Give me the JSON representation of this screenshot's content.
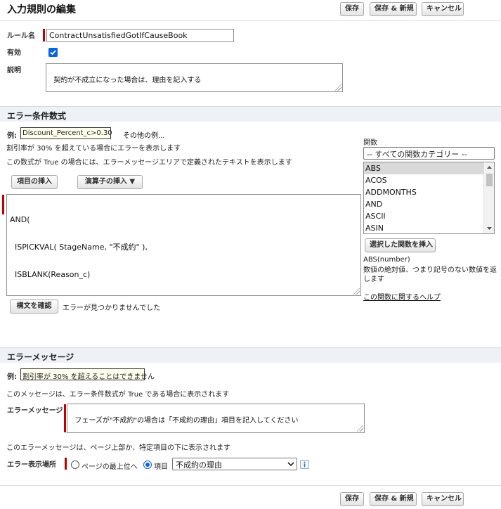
{
  "header": {
    "title": "入力規則の編集",
    "save": "保存",
    "save_new": "保存 & 新規",
    "cancel": "キャンセル"
  },
  "rule": {
    "name_label": "ルール名",
    "name_value": "ContractUnsatisfiedGotIfCauseBook",
    "active_label": "有効",
    "active_checked": true,
    "description_label": "説明",
    "description_value": "契約が不成立になった場合は、理由を記入する"
  },
  "formula_section": {
    "title": "エラー条件数式",
    "example_label": "例:",
    "example_value": "Discount_Percent_c>0.30",
    "more_examples": "その他の例...",
    "hint1": "割引率が 30% を超えている場合にエラーを表示します",
    "hint2": "この数式が True の場合には、エラーメッセージエリアで定義されたテキストを表示します",
    "insert_field": "項目の挿入",
    "insert_operator": "演算子の挿入 ▼",
    "formula_lines": [
      "AND(",
      "  ISPICKVAL( StageName, \"不成約\" ),",
      "  ISBLANK(Reason_c)",
      ")"
    ],
    "check_syntax": "構文を確認",
    "syntax_result": "エラーが見つかりませんでした"
  },
  "functions": {
    "label": "関数",
    "category": "-- すべての関数カテゴリー --",
    "items": [
      "ABS",
      "ACOS",
      "ADDMONTHS",
      "AND",
      "ASCII",
      "ASIN"
    ],
    "selected_index": 0,
    "insert_selected": "選択した関数を挿入",
    "signature": "ABS(number)",
    "description": "数値の絶対値、つまり記号のない数値を返します",
    "help_link": "この関数に関するヘルプ"
  },
  "error_section": {
    "title": "エラーメッセージ",
    "example_label": "例:",
    "example_value": "割引率が 30% を超えることはできません",
    "hint1": "このメッセージは、エラー条件数式が True である場合に表示されます",
    "message_label": "エラーメッセージ",
    "message_value": "フェーズが\"不成約\"の場合は「不成約の理由」項目を記入してください",
    "hint2": "このエラーメッセージは、ページ上部か、特定項目の下に表示されます",
    "location_label": "エラー表示場所",
    "option_top": "ページの最上位へ",
    "option_field": "項目",
    "selected_option": "field",
    "field_value": "不成約の理由"
  },
  "footer": {
    "save": "保存",
    "save_new": "保存 & 新規",
    "cancel": "キャンセル"
  },
  "colors": {
    "section_bg": "#eef1f6",
    "required": "#c00000",
    "accent": "#0b64d8"
  }
}
